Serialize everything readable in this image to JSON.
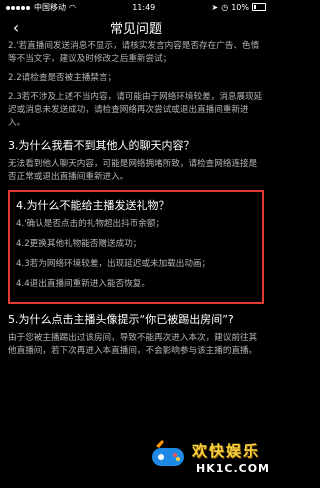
{
  "status_bar": {
    "carrier": "中国移动",
    "time": "11:49",
    "battery": "10%"
  },
  "nav": {
    "title": "常见问题"
  },
  "section2": {
    "items": [
      "2.'若直播间发送消息不显示，请核实发言内容是否存在广告、色情等不当文字，建议及时修改之后重新尝试；",
      "2.2请检查是否被主播禁言；",
      "2.3若不涉及上述不当内容，请可能由于网络环境较差，消息展现延迟或消息未发送成功，请检查网络再次尝试或退出直播间重新进入。"
    ]
  },
  "section3": {
    "title": "3.为什么我看不到其他人的聊天内容？",
    "body": "无法看到他人聊天内容，可能是网络拥堵所致，请检查网络连接是否正常或退出直播间重新进入。"
  },
  "section4": {
    "title": "4.为什么不能给主播发送礼物？",
    "items": [
      "4.'确认是否点击的礼物超出抖币余额；",
      "4.2更换其他礼物能否赠送成功；",
      "4.3若为网络环境较差，出现延迟或未加载出动画；",
      "4.4退出直播间重新进入能否恢复。"
    ]
  },
  "section5": {
    "title": "5.为什么点击主播头像提示“你已被踢出房间”?",
    "body": "由于您被主播踢出过该房间，导致不能再次进入本次，建议前往其他直播间，若下次再进入本直播间，不会影响参与该主播的直播。"
  },
  "watermark": {
    "brand": "欢快娱乐",
    "site": "HK1C.COM"
  }
}
